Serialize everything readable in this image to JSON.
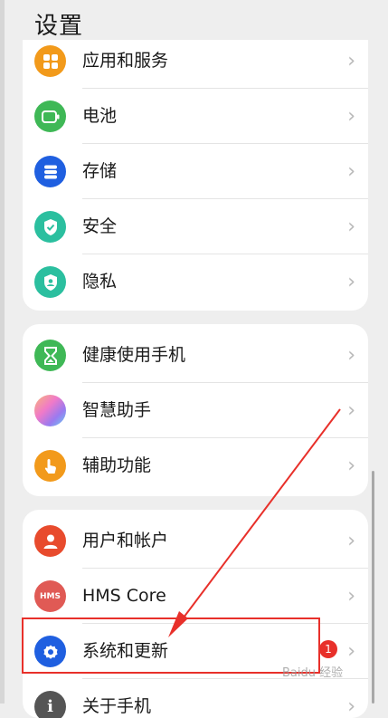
{
  "header": {
    "title": "设置"
  },
  "groups": [
    {
      "items": [
        {
          "label": "应用和服务",
          "icon": "apps-icon",
          "color": "#f29a1b"
        },
        {
          "label": "电池",
          "icon": "battery-icon",
          "color": "#3fb856"
        },
        {
          "label": "存储",
          "icon": "storage-icon",
          "color": "#1f5fe0"
        },
        {
          "label": "安全",
          "icon": "shield-check-icon",
          "color": "#2bbf9f"
        },
        {
          "label": "隐私",
          "icon": "privacy-shield-icon",
          "color": "#2bbf9f"
        }
      ]
    },
    {
      "items": [
        {
          "label": "健康使用手机",
          "icon": "hourglass-icon",
          "color": "#3fb856"
        },
        {
          "label": "智慧助手",
          "icon": "assistant-orb-icon",
          "color": "#c58bf0"
        },
        {
          "label": "辅助功能",
          "icon": "hand-icon",
          "color": "#f29a1b"
        }
      ]
    },
    {
      "items": [
        {
          "label": "用户和帐户",
          "icon": "user-icon",
          "color": "#e84b2d"
        },
        {
          "label": "HMS Core",
          "icon": "hms-core-icon",
          "icon_text": "HMS",
          "color": "#e05a55"
        },
        {
          "label": "系统和更新",
          "icon": "gear-icon",
          "color": "#1f5fe0",
          "badge": "1"
        },
        {
          "label": "关于手机",
          "icon": "info-icon",
          "color": "#555555"
        }
      ]
    }
  ],
  "chevron": "›",
  "watermark": "Baidu 经验",
  "annotation_color": "#e8302a"
}
